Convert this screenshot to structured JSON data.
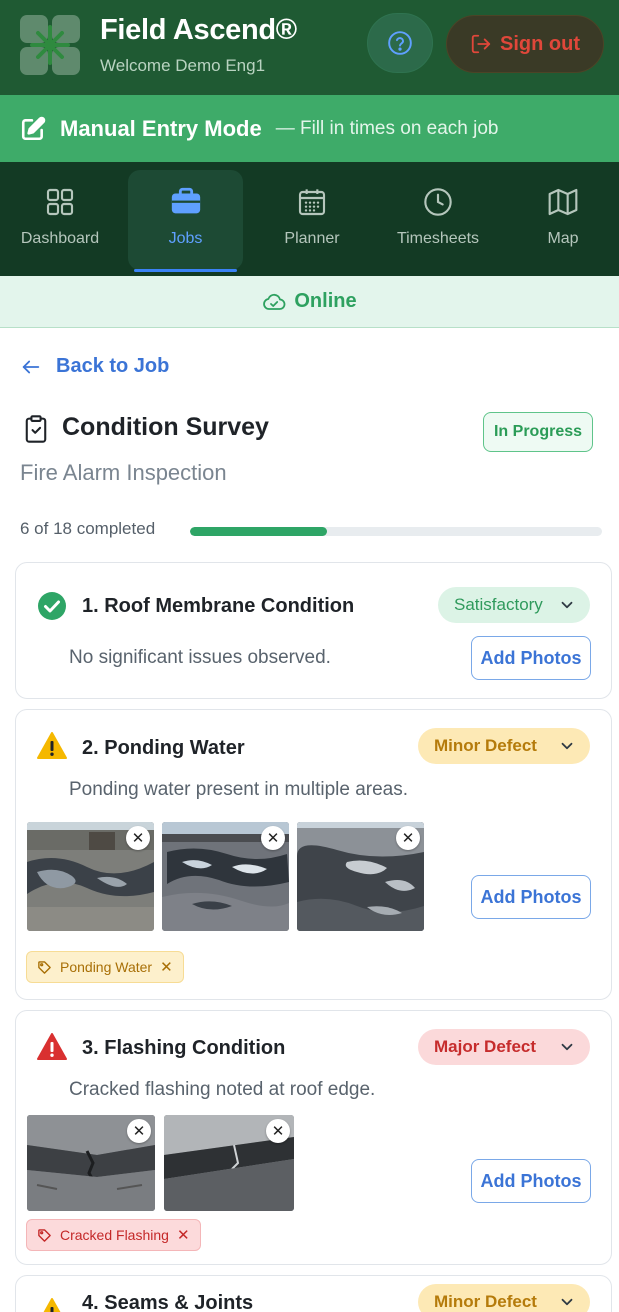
{
  "header": {
    "app_title": "Field Ascend®",
    "welcome": "Welcome Demo Eng1",
    "help_icon": "help-circle-icon",
    "sign_out_label": "Sign out",
    "sign_out_icon": "logout-icon"
  },
  "mode_banner": {
    "title": "Manual Entry Mode",
    "subtitle": "— Fill in times on each job",
    "icon": "edit-icon"
  },
  "nav": {
    "items": [
      {
        "label": "Dashboard",
        "icon": "grid-icon",
        "active": false
      },
      {
        "label": "Jobs",
        "icon": "briefcase-icon",
        "active": true
      },
      {
        "label": "Planner",
        "icon": "calendar-icon",
        "active": false
      },
      {
        "label": "Timesheets",
        "icon": "clock-icon",
        "active": false
      },
      {
        "label": "Map",
        "icon": "map-icon",
        "active": false
      }
    ]
  },
  "connection": {
    "label": "Online",
    "icon": "cloud-check-icon"
  },
  "back": {
    "label": "Back to Job",
    "icon": "arrow-left-icon"
  },
  "survey": {
    "title": "Condition Survey",
    "subtitle": "Fire Alarm Inspection",
    "status": "In Progress",
    "progress_text": "6 of 18 completed",
    "completed": 6,
    "total": 18
  },
  "items": [
    {
      "title": "1. Roof Membrane Condition",
      "rating": "Satisfactory",
      "status_icon": "check-circle-icon",
      "note": "No significant issues observed.",
      "add_photos": "Add Photos"
    },
    {
      "title": "2. Ponding Water",
      "rating": "Minor Defect",
      "status_icon": "warning-icon",
      "note": "Ponding water present in multiple areas.",
      "add_photos": "Add Photos",
      "tag": "Ponding Water"
    },
    {
      "title": "3. Flashing Condition",
      "rating": "Major Defect",
      "status_icon": "alert-triangle-icon",
      "note": "Cracked flashing noted at roof edge.",
      "add_photos": "Add Photos",
      "tag": "Cracked Flashing"
    },
    {
      "title": "4. Seams & Joints",
      "rating": "Minor Defect",
      "status_icon": "warning-icon"
    }
  ],
  "colors": {
    "header": "#1f5a33",
    "banner": "#3eab69",
    "nav": "#133a24",
    "accent": "#3b74d6",
    "success": "#2ea566",
    "minor": "#f5b800",
    "major": "#d93030"
  }
}
